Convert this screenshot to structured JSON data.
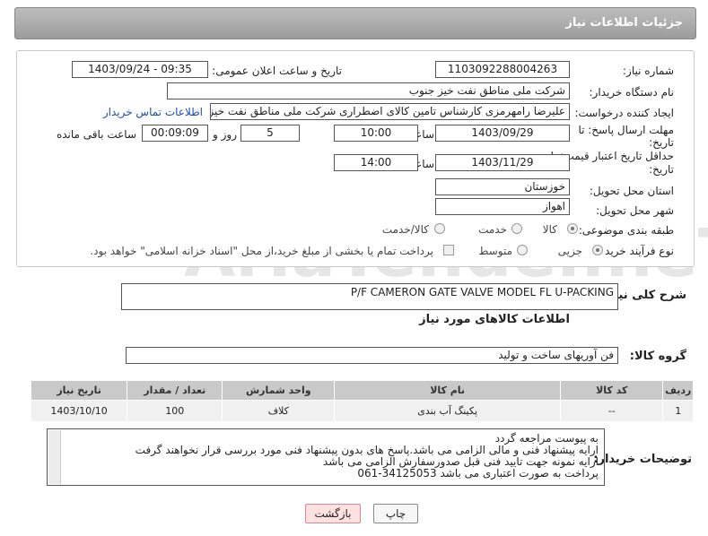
{
  "header": {
    "title": "جزئیات اطلاعات نیاز"
  },
  "form": {
    "need_number_label": "شماره نیاز:",
    "need_number": "1103092288004263",
    "announce_label": "تاریخ و ساعت اعلان عمومی:",
    "announce_value": "1403/09/24 - 09:35",
    "buyer_label": "نام دستگاه خریدار:",
    "buyer_value": "شرکت ملی مناطق نفت خیز جنوب",
    "creator_label": "ایجاد کننده درخواست:",
    "creator_value": "علیرضا رامهرمزی کارشناس تامین کالای اضطراری شرکت ملی مناطق نفت خیز جنوب",
    "contact_link": "اطلاعات تماس خریدار",
    "deadline_label_1": "مهلت ارسال پاسخ: تا",
    "deadline_label_2": "تاریخ:",
    "deadline_date": "1403/09/29",
    "time_label": "ساعت",
    "deadline_time": "10:00",
    "days_value": "5",
    "days_label": "روز و",
    "remaining_time": "00:09:09",
    "remaining_label": "ساعت باقی مانده",
    "validity_label_1": "حداقل تاریخ اعتبار قیمت: تا",
    "validity_label_2": "تاریخ:",
    "validity_date": "1403/11/29",
    "validity_time_label": "ساعت",
    "validity_time": "14:00",
    "province_label": "استان محل تحویل:",
    "province_value": "خوزستان",
    "city_label": "شهر محل تحویل:",
    "city_value": "اهواز",
    "category_label": "طبقه بندی موضوعی:",
    "category_options": [
      "کالا",
      "خدمت",
      "کالا/خدمت"
    ],
    "process_label": "نوع فرآیند خرید :",
    "process_options": [
      "جزیی",
      "متوسط"
    ],
    "payment_note": "پرداخت تمام یا بخشی از مبلغ خرید،از محل \"اسناد خزانه اسلامی\" خواهد بود."
  },
  "general_desc": {
    "label": "شرح کلی نیاز:",
    "value": "P/F CAMERON GATE VALVE MODEL FL U-PACKING"
  },
  "goods_section": {
    "title": "اطلاعات کالاهای مورد نیاز"
  },
  "goods_group": {
    "label": "گروه کالا:",
    "value": "فن آوریهای ساخت و تولید"
  },
  "table": {
    "headers": [
      "ردیف",
      "کد کالا",
      "نام کالا",
      "واحد شمارش",
      "تعداد / مقدار",
      "تاریخ نیاز"
    ],
    "rows": [
      [
        "1",
        "--",
        "پکینگ آب بندی",
        "کلاف",
        "100",
        "1403/10/10"
      ]
    ]
  },
  "buyer_notes": {
    "label": "توضیحات خریدار:",
    "lines": [
      "به پیوست مراجعه گردد",
      "ارایه پیشنهاد فنی و مالی الزامی می باشد.پاسخ های بدون پیشنهاد فنی مورد بررسی قرار نخواهند گرفت",
      "ارایه نمونه جهت تایید فنی قبل صدورسفارش الزامی می باشد",
      "پرداخت به صورت اعتباری می باشد 34125053-061"
    ]
  },
  "buttons": {
    "print": "چاپ",
    "back": "بازگشت"
  },
  "watermark": "AriaTender.neT"
}
